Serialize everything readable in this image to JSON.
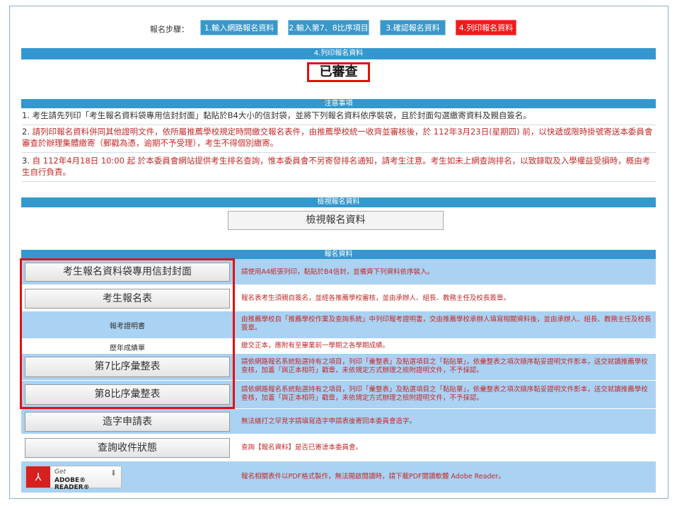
{
  "steps": {
    "label": "報名步驟：",
    "items": [
      {
        "label": "1.輸入網路報名資料"
      },
      {
        "label": "2.輸入第7、8比序項目"
      },
      {
        "label": "3.確認報名資料"
      },
      {
        "label": "4.列印報名資料"
      }
    ],
    "active_color": "#ef1b1b",
    "color": "#3a97c9"
  },
  "section_print": {
    "header": "4.列印報名資料",
    "status": "已審查"
  },
  "notice": {
    "header": "注意事項",
    "items": [
      {
        "num": "1.",
        "text": "考生請先列印「考生報名資料袋專用信封封面」黏貼於B4大小的信封袋，並將下列報名資料依序裝袋，且於封面勾選繳寄資料及親自簽名。"
      },
      {
        "num": "2.",
        "text": "請列印報名資料併同其他證明文件，依所屬推薦學校規定時間繳交報名表件，由推薦學校統一收齊並審核後，於 112年3月23日(星期四) 前，以快遞或限時掛號寄送本委員會審查於辦理集體繳寄（郵戳為憑，逾期不予受理），考生不得個別繳寄。"
      },
      {
        "num": "3.",
        "text": "自 112年4月18日 10:00 起 於本委員會網站提供考生排名查詢，惟本委員會不另寄發排名通知，請考生注意。考生如未上網查詢排名，以致錄取及入學權益受損時，概由考生自行負責。"
      }
    ]
  },
  "view_section": {
    "header": "檢視報名資料",
    "button": "檢視報名資料"
  },
  "materials": {
    "header": "報名資料",
    "rows": [
      {
        "label": "考生報名資料袋專用信封封面",
        "desc": "請使用A4紙張列印，黏貼於B4信封，並備齊下列資料依序裝入。"
      },
      {
        "label": "考生報名表",
        "desc": "報名表考生須親自簽名，並經各推薦學校審核，並由承辦人、組長、教務主任及校長簽章。"
      },
      {
        "label": "報考證明書",
        "desc": "由推薦學校自「推薦學校作業及查詢系統」中列印報考證明書，交由推薦學校承辦人填寫相關資料後，並由承辦人、組長、教務主任及校長簽章。"
      },
      {
        "label": "歷年成績單",
        "desc": "繳交正本，應附有至畢業前一學期之各學期成績。"
      },
      {
        "label": "第7比序彙整表",
        "desc": "請依網路報名系統點選持有之項目，列印「彙整表」及點選項目之「黏貼單」，依彙整表之項次順序黏妥證明文件影本，送交就讀推薦學校查核，加蓋「與正本相符」戳章，未依規定方式辦理之檢附證明文件，不予採認。"
      },
      {
        "label": "第8比序彙整表",
        "desc": "請依網路報名系統點選持有之項目，列印「彙整表」及點選項目之「黏貼單」，依彙整表之項次順序黏妥證明文件影本，送交就讀推薦學校查核，加蓋「與正本相符」戳章，未依規定方式辦理之檢附證明文件，不予採認。"
      },
      {
        "label": "造字申請表",
        "desc": "無法繕打之罕見字請填寫造字申請表後寄回本委員會造字。"
      },
      {
        "label": "查詢收件狀態",
        "desc": "查詢【報名資料】是否已寄達本委員會。"
      }
    ],
    "adobe": {
      "get": "Get",
      "name": "ADOBE® READER®",
      "desc": "報名相關表件以PDF格式製作，無法開啟閱讀時，請下載PDF閱讀軟體 Adobe Reader。"
    }
  }
}
